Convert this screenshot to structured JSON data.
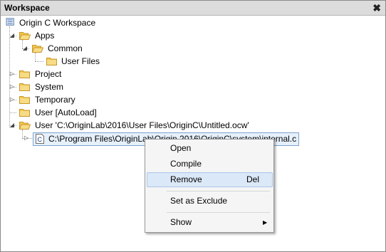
{
  "window": {
    "title": "Workspace",
    "close_glyph": "✖"
  },
  "tree": {
    "root": "Origin C Workspace",
    "apps": "Apps",
    "common": "Common",
    "user_files": "User Files",
    "project": "Project",
    "system": "System",
    "temporary": "Temporary",
    "user_autoload": "User  [AutoLoad]",
    "user_path": "User 'C:\\OriginLab\\2016\\User Files\\OriginC\\Untitled.ocw'",
    "selected_file": "C:\\Program Files\\OriginLab\\Origin 2016\\OriginC\\system\\internal.c",
    "file_icon_letter": "C"
  },
  "context_menu": {
    "open": "Open",
    "compile": "Compile",
    "remove": "Remove",
    "remove_shortcut": "Del",
    "set_as_exclude": "Set as Exclude",
    "show": "Show"
  },
  "colors": {
    "folder": "#f2c94c",
    "folder_edge": "#c9962b",
    "selection": "#e6f0fb",
    "menu_highlight": "#dbe8f7"
  }
}
